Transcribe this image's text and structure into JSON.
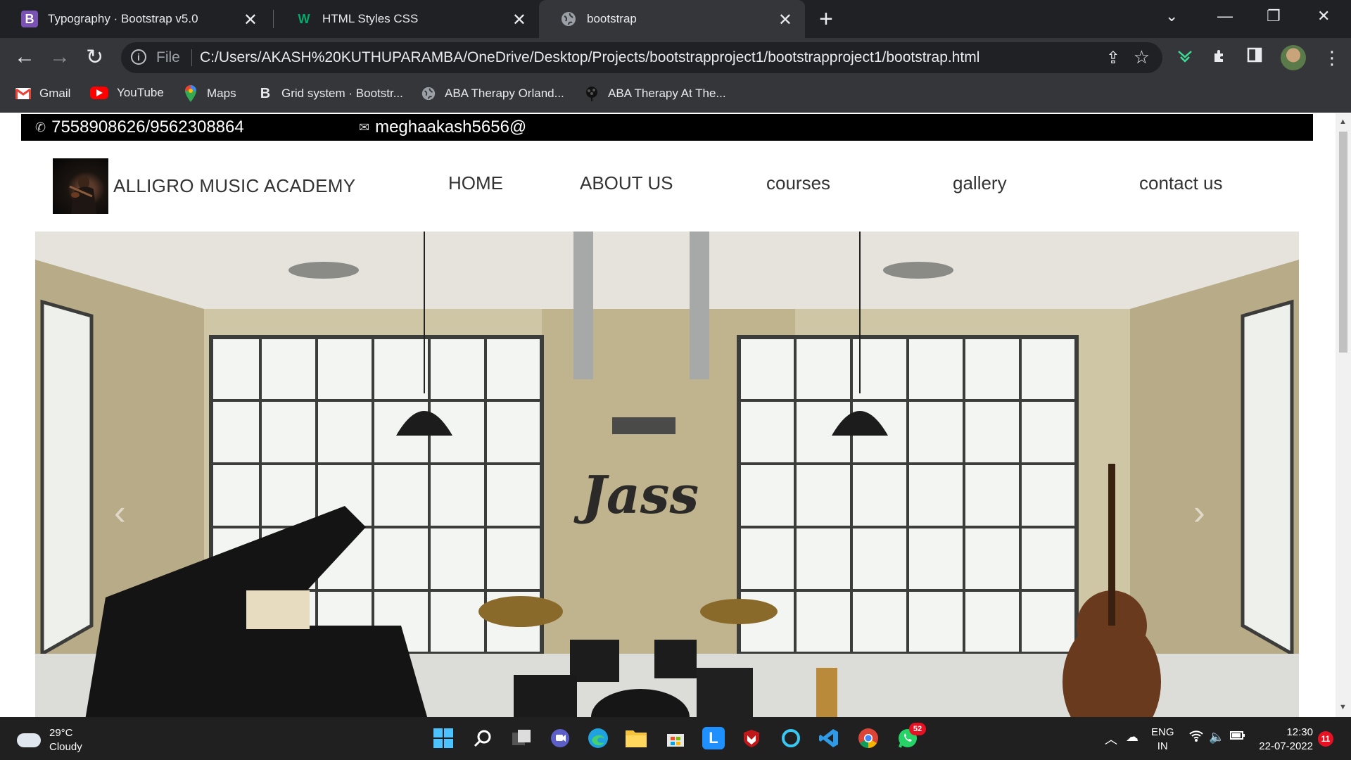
{
  "browser": {
    "tabs": [
      {
        "title": "Typography · Bootstrap v5.0",
        "favicon": "B",
        "favicon_color": "#7952b3"
      },
      {
        "title": "HTML Styles CSS",
        "favicon": "W",
        "favicon_color": "#04aa6d"
      },
      {
        "title": "bootstrap",
        "favicon": "globe"
      }
    ],
    "address": {
      "scheme_label": "File",
      "url": "C:/Users/AKASH%20KUTHUPARAMBA/OneDrive/Desktop/Projects/bootstrapproject1/bootstrapproject1/bootstrap.html"
    },
    "bookmarks": [
      {
        "label": "Gmail",
        "icon": "gmail-icon"
      },
      {
        "label": "YouTube",
        "icon": "youtube-icon"
      },
      {
        "label": "Maps",
        "icon": "maps-icon"
      },
      {
        "label": "Grid system · Bootstr...",
        "icon": "bootstrap-icon"
      },
      {
        "label": "ABA Therapy Orland...",
        "icon": "globe-icon"
      },
      {
        "label": "ABA Therapy At The...",
        "icon": "tree-icon"
      }
    ]
  },
  "site": {
    "topbar": {
      "phone": "7558908626/9562308864",
      "email": "meghaakash5656@"
    },
    "brand": "ALLIGRO MUSIC ACADEMY",
    "nav": [
      "HOME",
      "ABOUT US",
      "courses",
      "gallery",
      "contact us"
    ],
    "hero": {
      "wall_text": "Jass",
      "prev": "‹",
      "next": "›"
    }
  },
  "taskbar": {
    "weather": {
      "temp": "29°C",
      "condition": "Cloudy"
    },
    "whatsapp_badge": "52",
    "language": {
      "line1": "ENG",
      "line2": "IN"
    },
    "clock": {
      "time": "12:30",
      "date": "22-07-2022"
    },
    "notifications": "11"
  },
  "colors": {
    "accent_bootstrap": "#7952b3",
    "w3schools": "#04aa6d",
    "topbar": "#000000",
    "taskbar": "#202020"
  }
}
